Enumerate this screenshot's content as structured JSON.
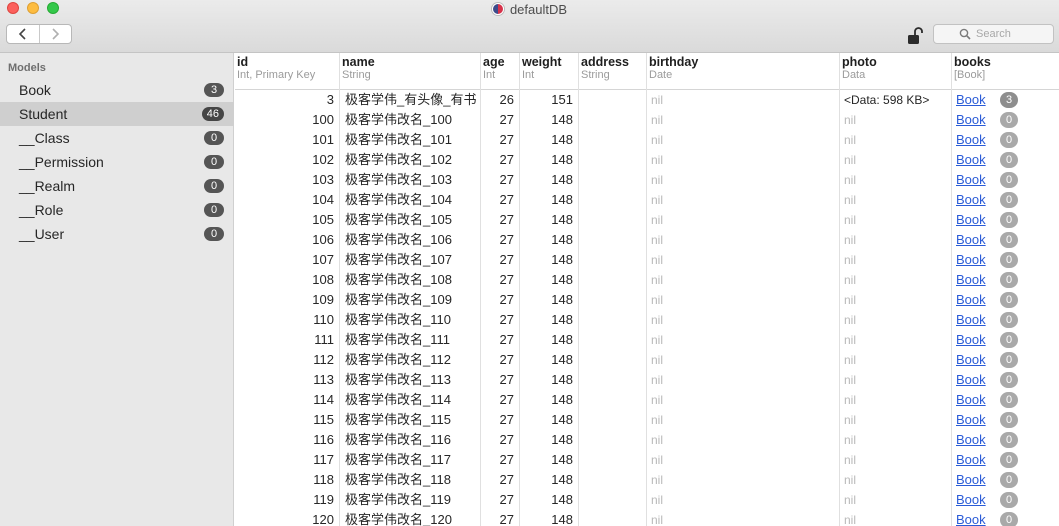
{
  "window": {
    "title": "defaultDB"
  },
  "toolbar": {
    "search_placeholder": "Search"
  },
  "sidebar": {
    "header": "Models",
    "items": [
      {
        "label": "Book",
        "count": "3",
        "selected": false
      },
      {
        "label": "Student",
        "count": "46",
        "selected": true
      },
      {
        "label": "__Class",
        "count": "0",
        "selected": false
      },
      {
        "label": "__Permission",
        "count": "0",
        "selected": false
      },
      {
        "label": "__Realm",
        "count": "0",
        "selected": false
      },
      {
        "label": "__Role",
        "count": "0",
        "selected": false
      },
      {
        "label": "__User",
        "count": "0",
        "selected": false
      }
    ]
  },
  "table": {
    "columns": [
      {
        "name": "id",
        "type": "Int, Primary Key"
      },
      {
        "name": "name",
        "type": "String"
      },
      {
        "name": "age",
        "type": "Int"
      },
      {
        "name": "weight",
        "type": "Int"
      },
      {
        "name": "address",
        "type": "String"
      },
      {
        "name": "birthday",
        "type": "Date"
      },
      {
        "name": "photo",
        "type": "Data"
      },
      {
        "name": "books",
        "type": "[Book]"
      }
    ],
    "rows": [
      {
        "id": "3",
        "name": "极客学伟_有头像_有书",
        "age": "26",
        "weight": "151",
        "address": "",
        "birthday": "nil",
        "photo": "<Data: 598 KB>",
        "books_label": "Book",
        "books_count": "3"
      },
      {
        "id": "100",
        "name": "极客学伟改名_100",
        "age": "27",
        "weight": "148",
        "address": "",
        "birthday": "nil",
        "photo": "nil",
        "books_label": "Book",
        "books_count": "0"
      },
      {
        "id": "101",
        "name": "极客学伟改名_101",
        "age": "27",
        "weight": "148",
        "address": "",
        "birthday": "nil",
        "photo": "nil",
        "books_label": "Book",
        "books_count": "0"
      },
      {
        "id": "102",
        "name": "极客学伟改名_102",
        "age": "27",
        "weight": "148",
        "address": "",
        "birthday": "nil",
        "photo": "nil",
        "books_label": "Book",
        "books_count": "0"
      },
      {
        "id": "103",
        "name": "极客学伟改名_103",
        "age": "27",
        "weight": "148",
        "address": "",
        "birthday": "nil",
        "photo": "nil",
        "books_label": "Book",
        "books_count": "0"
      },
      {
        "id": "104",
        "name": "极客学伟改名_104",
        "age": "27",
        "weight": "148",
        "address": "",
        "birthday": "nil",
        "photo": "nil",
        "books_label": "Book",
        "books_count": "0"
      },
      {
        "id": "105",
        "name": "极客学伟改名_105",
        "age": "27",
        "weight": "148",
        "address": "",
        "birthday": "nil",
        "photo": "nil",
        "books_label": "Book",
        "books_count": "0"
      },
      {
        "id": "106",
        "name": "极客学伟改名_106",
        "age": "27",
        "weight": "148",
        "address": "",
        "birthday": "nil",
        "photo": "nil",
        "books_label": "Book",
        "books_count": "0"
      },
      {
        "id": "107",
        "name": "极客学伟改名_107",
        "age": "27",
        "weight": "148",
        "address": "",
        "birthday": "nil",
        "photo": "nil",
        "books_label": "Book",
        "books_count": "0"
      },
      {
        "id": "108",
        "name": "极客学伟改名_108",
        "age": "27",
        "weight": "148",
        "address": "",
        "birthday": "nil",
        "photo": "nil",
        "books_label": "Book",
        "books_count": "0"
      },
      {
        "id": "109",
        "name": "极客学伟改名_109",
        "age": "27",
        "weight": "148",
        "address": "",
        "birthday": "nil",
        "photo": "nil",
        "books_label": "Book",
        "books_count": "0"
      },
      {
        "id": "110",
        "name": "极客学伟改名_110",
        "age": "27",
        "weight": "148",
        "address": "",
        "birthday": "nil",
        "photo": "nil",
        "books_label": "Book",
        "books_count": "0"
      },
      {
        "id": "111",
        "name": "极客学伟改名_111",
        "age": "27",
        "weight": "148",
        "address": "",
        "birthday": "nil",
        "photo": "nil",
        "books_label": "Book",
        "books_count": "0"
      },
      {
        "id": "112",
        "name": "极客学伟改名_112",
        "age": "27",
        "weight": "148",
        "address": "",
        "birthday": "nil",
        "photo": "nil",
        "books_label": "Book",
        "books_count": "0"
      },
      {
        "id": "113",
        "name": "极客学伟改名_113",
        "age": "27",
        "weight": "148",
        "address": "",
        "birthday": "nil",
        "photo": "nil",
        "books_label": "Book",
        "books_count": "0"
      },
      {
        "id": "114",
        "name": "极客学伟改名_114",
        "age": "27",
        "weight": "148",
        "address": "",
        "birthday": "nil",
        "photo": "nil",
        "books_label": "Book",
        "books_count": "0"
      },
      {
        "id": "115",
        "name": "极客学伟改名_115",
        "age": "27",
        "weight": "148",
        "address": "",
        "birthday": "nil",
        "photo": "nil",
        "books_label": "Book",
        "books_count": "0"
      },
      {
        "id": "116",
        "name": "极客学伟改名_116",
        "age": "27",
        "weight": "148",
        "address": "",
        "birthday": "nil",
        "photo": "nil",
        "books_label": "Book",
        "books_count": "0"
      },
      {
        "id": "117",
        "name": "极客学伟改名_117",
        "age": "27",
        "weight": "148",
        "address": "",
        "birthday": "nil",
        "photo": "nil",
        "books_label": "Book",
        "books_count": "0"
      },
      {
        "id": "118",
        "name": "极客学伟改名_118",
        "age": "27",
        "weight": "148",
        "address": "",
        "birthday": "nil",
        "photo": "nil",
        "books_label": "Book",
        "books_count": "0"
      },
      {
        "id": "119",
        "name": "极客学伟改名_119",
        "age": "27",
        "weight": "148",
        "address": "",
        "birthday": "nil",
        "photo": "nil",
        "books_label": "Book",
        "books_count": "0"
      },
      {
        "id": "120",
        "name": "极客学伟改名_120",
        "age": "27",
        "weight": "148",
        "address": "",
        "birthday": "nil",
        "photo": "nil",
        "books_label": "Book",
        "books_count": "0"
      }
    ]
  },
  "colors": {
    "link": "#2a5bd7",
    "nil_text": "#b9b9b9",
    "sidebar_bg": "#e8e8e8",
    "sidebar_selected": "#cfcfcf",
    "badge": "#555555"
  },
  "icons": {
    "back": "chevron-left-icon",
    "forward": "chevron-right-icon",
    "lock": "unlocked-padlock-icon",
    "search": "magnifier-icon",
    "database": "database-icon"
  }
}
